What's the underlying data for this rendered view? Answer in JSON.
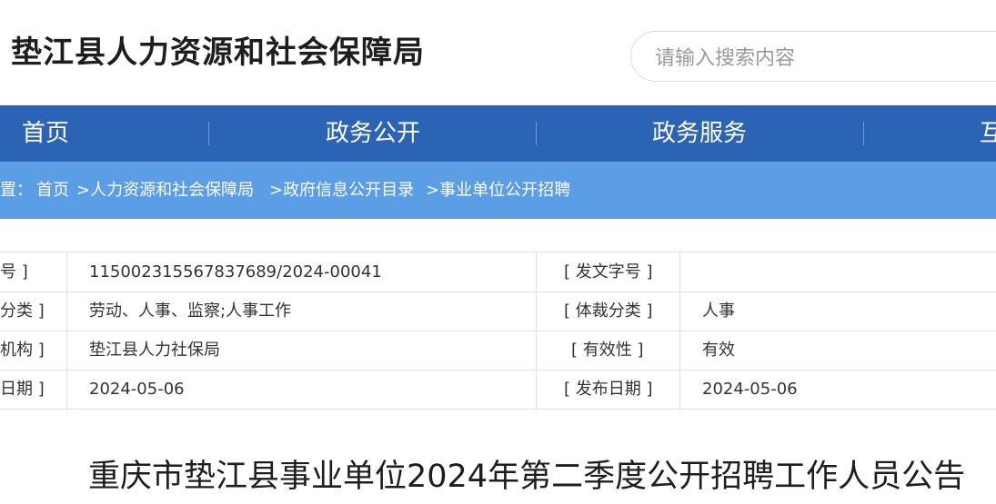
{
  "header": {
    "site_title": "垫江县人力资源和社会保障局",
    "search_placeholder": "请输入搜索内容"
  },
  "nav": {
    "items": [
      "首页",
      "政务公开",
      "政务服务",
      "互"
    ]
  },
  "breadcrumb": {
    "prefix": "置：",
    "items": [
      "首页",
      ">人力资源和社会保障局",
      ">政府信息公开目录",
      ">事业单位公开招聘"
    ]
  },
  "meta": {
    "rows": [
      {
        "label1": "号 ]",
        "value1": "115002315567837689/2024-00041",
        "label2": "[ 发文字号 ]",
        "value2": ""
      },
      {
        "label1": "分类 ]",
        "value1": "劳动、人事、监察;人事工作",
        "label2": "[ 体裁分类 ]",
        "value2": "人事"
      },
      {
        "label1": "机构 ]",
        "value1": "垫江县人力社保局",
        "label2": "[ 有效性 ]",
        "value2": "有效"
      },
      {
        "label1": "日期 ]",
        "value1": "2024-05-06",
        "label2": "[ 发布日期 ]",
        "value2": "2024-05-06"
      }
    ]
  },
  "article": {
    "title": "重庆市垫江县事业单位2024年第二季度公开招聘工作人员公告"
  }
}
